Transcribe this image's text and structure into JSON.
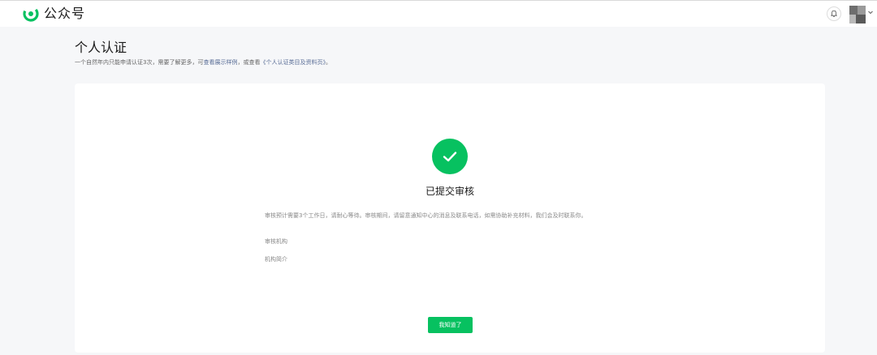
{
  "header": {
    "app_name": "公众号",
    "logo_icon": "wechat-official-account-logo",
    "bell_icon": "bell-icon",
    "avatar_icon": "avatar",
    "caret_icon": "chevron-down-icon",
    "brand_color": "#07c160"
  },
  "page": {
    "title": "个人认证",
    "intro_prefix": "一个自然年内只能申请认证3次，需要了解更多，可",
    "intro_link_1": "查看展示样例",
    "intro_mid": "，或查看",
    "intro_link_2": "《个人认证类目及资料页》",
    "intro_suffix": "。"
  },
  "result": {
    "status_icon": "check-circle-icon",
    "title": "已提交审核",
    "description": "审核预计需要3个工作日，请耐心等待。审核期间，请留意通知中心的消息及联系电话，如需协助补充材料，我们会及时联系你。",
    "field_review_org": "审核机构",
    "field_org_intro": "机构简介",
    "ok_button": "我知道了"
  }
}
